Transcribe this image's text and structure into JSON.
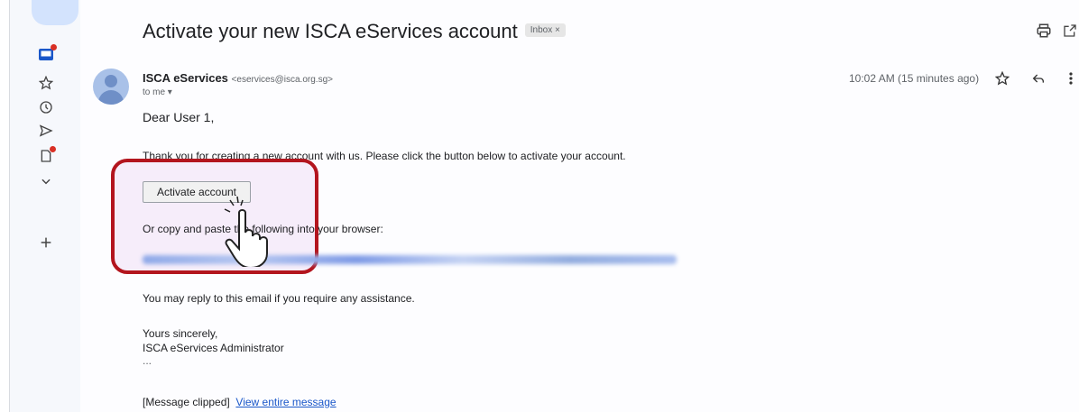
{
  "email": {
    "subject": "Activate your new ISCA eServices account",
    "label_chip": "Inbox ×",
    "sender_name": "ISCA eServices",
    "sender_email": "<eservices@isca.org.sg>",
    "to_line": "to me ▾",
    "time": "10:02 AM (15 minutes ago)",
    "greeting": "Dear User 1,",
    "body_line1": "Thank you for creating a new account with us. Please click the button below to activate your account.",
    "activate_button": "Activate account",
    "body_line2": "Or copy and paste the following into your browser:",
    "body_line3": "You may reply to this email if you require any assistance.",
    "signoff": "Yours sincerely,",
    "signature": "ISCA eServices Administrator",
    "ellipsis": "...",
    "clipped": "[Message clipped]",
    "view_entire": "View entire message"
  },
  "rail_icons": [
    "inbox-icon",
    "star-icon",
    "clock-icon",
    "send-icon",
    "draft-icon",
    "chevron-down-icon",
    "plus-icon"
  ],
  "colors": {
    "highlight": "#b3151e",
    "link": "#1a57c9",
    "badge": "#d93025"
  }
}
